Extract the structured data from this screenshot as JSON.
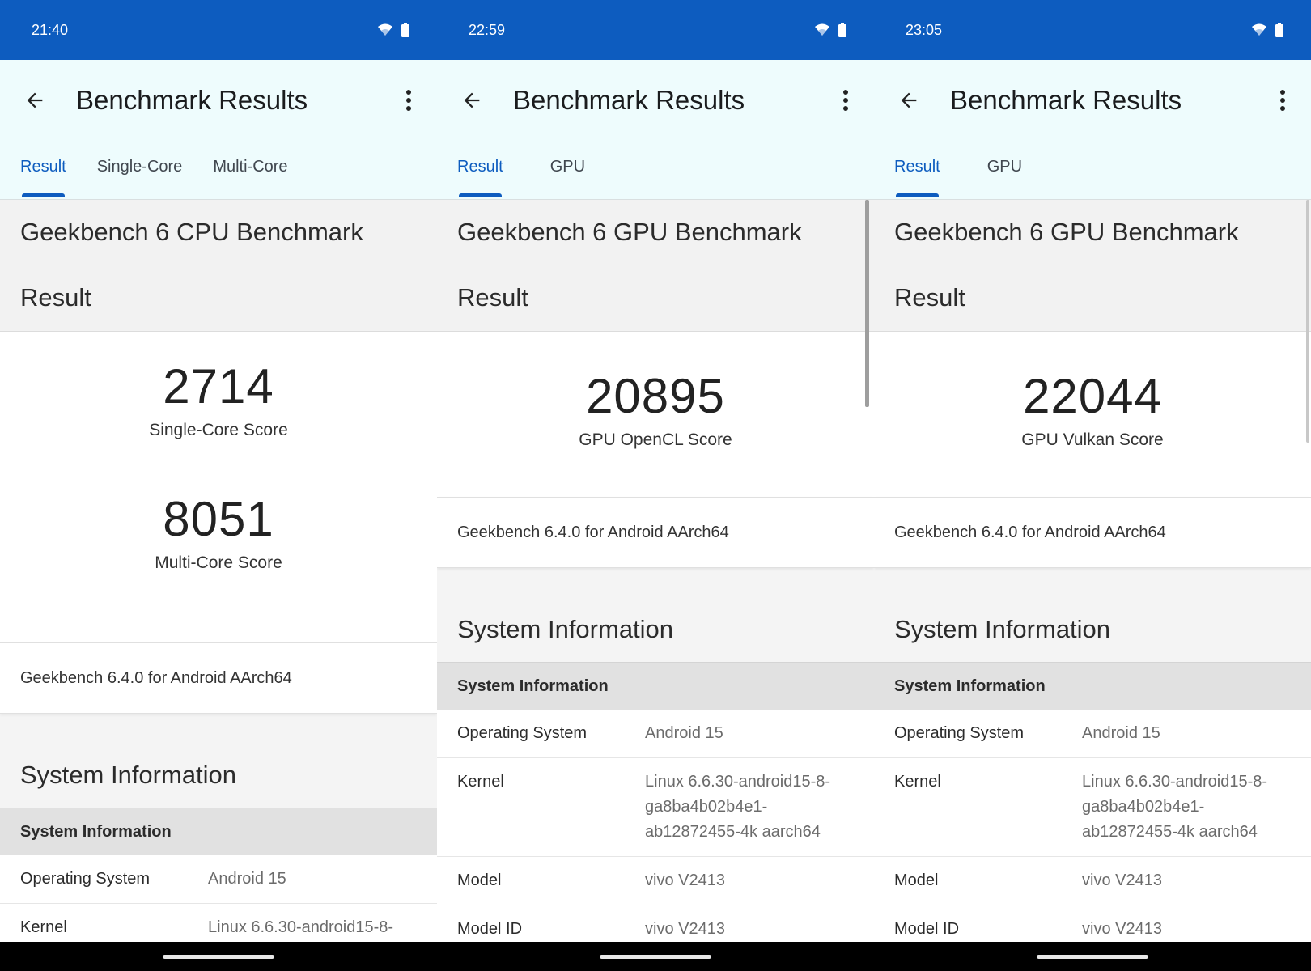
{
  "screens": [
    {
      "status": {
        "time": "21:40"
      },
      "appbar": {
        "title": "Benchmark Results"
      },
      "tabs": [
        "Result",
        "Single-Core",
        "Multi-Core"
      ],
      "benchmark": {
        "title": "Geekbench 6 CPU Benchmark",
        "subtitle": "Result"
      },
      "scores": [
        {
          "value": "2714",
          "label": "Single-Core Score"
        },
        {
          "value": "8051",
          "label": "Multi-Core Score"
        }
      ],
      "version": "Geekbench 6.4.0 for Android AArch64",
      "system": {
        "heading": "System Information",
        "bar": "System Information",
        "rows": [
          {
            "key": "Operating System",
            "value": "Android 15"
          },
          {
            "key": "Kernel",
            "value": "Linux 6.6.30-android15-8-"
          }
        ]
      }
    },
    {
      "status": {
        "time": "22:59"
      },
      "appbar": {
        "title": "Benchmark Results"
      },
      "tabs": [
        "Result",
        "GPU"
      ],
      "benchmark": {
        "title": "Geekbench 6 GPU Benchmark",
        "subtitle": "Result"
      },
      "scores": [
        {
          "value": "20895",
          "label": "GPU OpenCL Score"
        }
      ],
      "version": "Geekbench 6.4.0 for Android AArch64",
      "system": {
        "heading": "System Information",
        "bar": "System Information",
        "rows": [
          {
            "key": "Operating System",
            "value": "Android 15"
          },
          {
            "key": "Kernel",
            "value": "Linux 6.6.30-android15-8-\nga8ba4b02b4e1-\nab12872455-4k aarch64"
          },
          {
            "key": "Model",
            "value": "vivo V2413"
          },
          {
            "key": "Model ID",
            "value": "vivo V2413"
          }
        ]
      }
    },
    {
      "status": {
        "time": "23:05"
      },
      "appbar": {
        "title": "Benchmark Results"
      },
      "tabs": [
        "Result",
        "GPU"
      ],
      "benchmark": {
        "title": "Geekbench 6 GPU Benchmark",
        "subtitle": "Result"
      },
      "scores": [
        {
          "value": "22044",
          "label": "GPU Vulkan Score"
        }
      ],
      "version": "Geekbench 6.4.0 for Android AArch64",
      "system": {
        "heading": "System Information",
        "bar": "System Information",
        "rows": [
          {
            "key": "Operating System",
            "value": "Android 15"
          },
          {
            "key": "Kernel",
            "value": "Linux 6.6.30-android15-8-\nga8ba4b02b4e1-\nab12872455-4k aarch64"
          },
          {
            "key": "Model",
            "value": "vivo V2413"
          },
          {
            "key": "Model ID",
            "value": "vivo V2413"
          }
        ]
      }
    }
  ],
  "colors": {
    "statusbar": "#0d5cbf",
    "appbar": "#eefcfd",
    "accent": "#0d5cbf"
  },
  "icons": [
    "wifi-icon",
    "battery-icon",
    "back-arrow-icon",
    "more-vert-icon"
  ]
}
